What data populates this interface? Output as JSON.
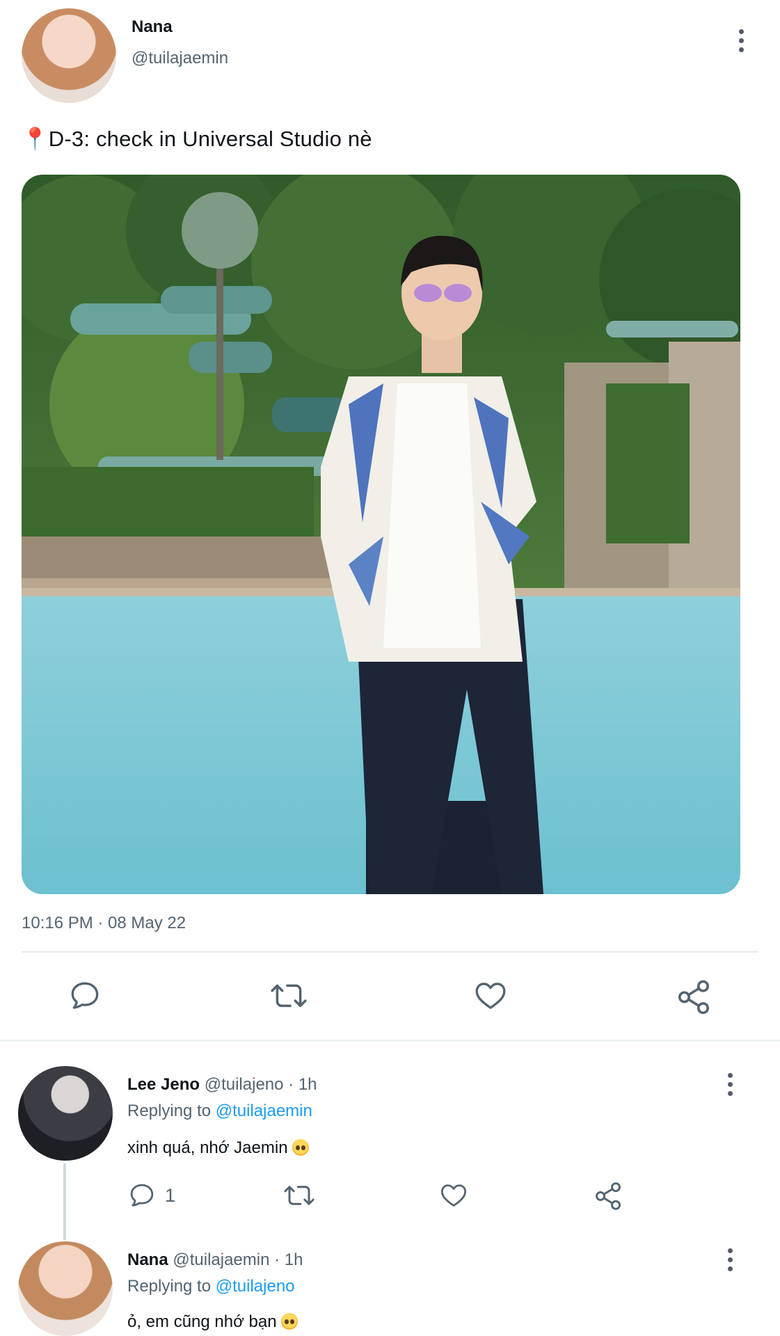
{
  "tweet": {
    "author_name": "Nana",
    "author_handle": "@tuilajaemin",
    "text": "📍D-3: check in Universal Studio nè",
    "timestamp": "10:16 PM · 08 May 22",
    "icons": {
      "more": "more-vertical-icon",
      "reply": "comment-icon",
      "retweet": "retweet-icon",
      "like": "heart-icon",
      "share": "share-icon"
    }
  },
  "replies": [
    {
      "author_name": "Lee Jeno",
      "author_handle": "@tuilajeno",
      "time": "· 1h",
      "replying_label": "Replying to",
      "replying_to": "@tuilajaemin",
      "text": "xinh quá, nhớ Jaemin",
      "emoji": "pleading-face-emoji",
      "reply_count": "1"
    },
    {
      "author_name": "Nana",
      "author_handle": "@tuilajaemin",
      "time": "· 1h",
      "replying_label": "Replying to",
      "replying_to": "@tuilajeno",
      "text": "ỏ, em cũng nhớ bạn",
      "emoji": "pleading-face-emoji"
    }
  ],
  "colors": {
    "link": "#1d9bf0",
    "muted": "#536471",
    "text": "#0f1419",
    "divider": "#e6e8eb"
  }
}
